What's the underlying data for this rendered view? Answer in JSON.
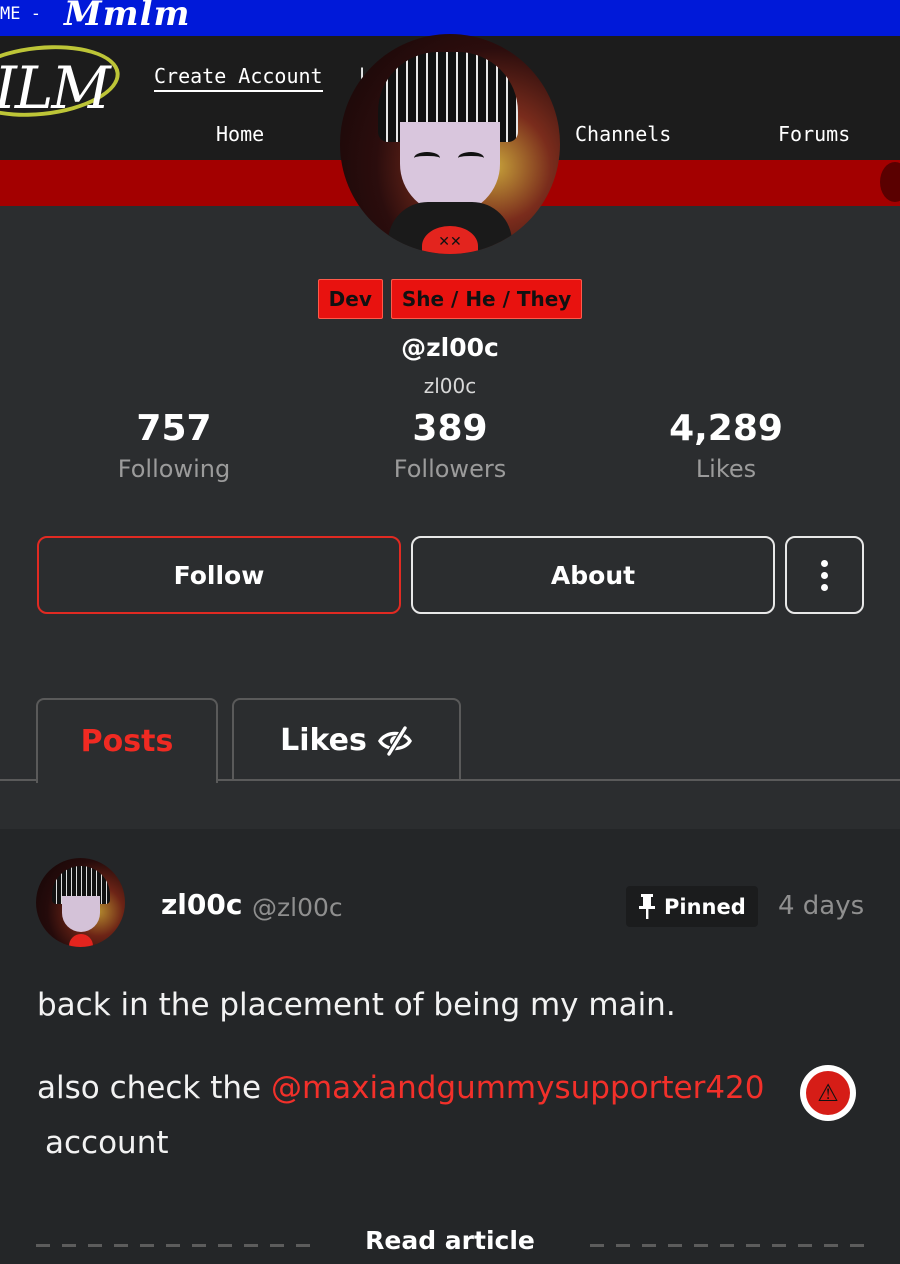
{
  "topbar": {
    "crumb": "ME -",
    "scribble": "Mmlm"
  },
  "site": {
    "logo": "ILM",
    "create_account": "Create Account",
    "pipe": "|",
    "nav": [
      "Home",
      "Channels",
      "Forums"
    ]
  },
  "profile": {
    "badges": [
      "Dev",
      "She / He / They"
    ],
    "handle": "@zl00c",
    "display_name": "zl00c",
    "stats": [
      {
        "value": "757",
        "label": "Following"
      },
      {
        "value": "389",
        "label": "Followers"
      },
      {
        "value": "4,289",
        "label": "Likes"
      }
    ],
    "actions": {
      "follow": "Follow",
      "about": "About"
    }
  },
  "tabs": [
    {
      "label": "Posts",
      "active": true
    },
    {
      "label": "Likes",
      "active": false,
      "icon": "eye-off-icon"
    }
  ],
  "post": {
    "author": "zl00c",
    "handle": "@zl00c",
    "pinned_label": "Pinned",
    "time": "4 days",
    "line1": "back in the placement of being my main.",
    "line2_prefix": "also check the ",
    "mention": "@maxiandgummysupporter420",
    "line3": "account",
    "read_more": "Read article"
  },
  "colors": {
    "accent_red": "#f02a22",
    "banner_blue": "#0019d9",
    "band_red": "#a30000",
    "bg": "#2b2d2f"
  }
}
